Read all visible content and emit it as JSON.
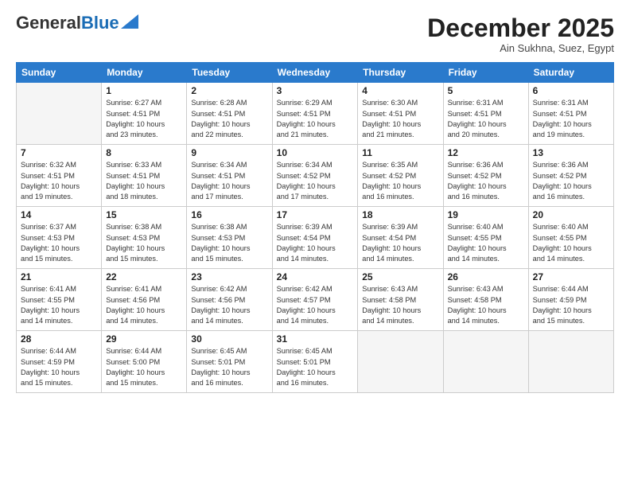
{
  "header": {
    "logo_general": "General",
    "logo_blue": "Blue",
    "month": "December 2025",
    "location": "Ain Sukhna, Suez, Egypt"
  },
  "days_of_week": [
    "Sunday",
    "Monday",
    "Tuesday",
    "Wednesday",
    "Thursday",
    "Friday",
    "Saturday"
  ],
  "weeks": [
    [
      {
        "day": "",
        "info": ""
      },
      {
        "day": "1",
        "info": "Sunrise: 6:27 AM\nSunset: 4:51 PM\nDaylight: 10 hours\nand 23 minutes."
      },
      {
        "day": "2",
        "info": "Sunrise: 6:28 AM\nSunset: 4:51 PM\nDaylight: 10 hours\nand 22 minutes."
      },
      {
        "day": "3",
        "info": "Sunrise: 6:29 AM\nSunset: 4:51 PM\nDaylight: 10 hours\nand 21 minutes."
      },
      {
        "day": "4",
        "info": "Sunrise: 6:30 AM\nSunset: 4:51 PM\nDaylight: 10 hours\nand 21 minutes."
      },
      {
        "day": "5",
        "info": "Sunrise: 6:31 AM\nSunset: 4:51 PM\nDaylight: 10 hours\nand 20 minutes."
      },
      {
        "day": "6",
        "info": "Sunrise: 6:31 AM\nSunset: 4:51 PM\nDaylight: 10 hours\nand 19 minutes."
      }
    ],
    [
      {
        "day": "7",
        "info": "Sunrise: 6:32 AM\nSunset: 4:51 PM\nDaylight: 10 hours\nand 19 minutes."
      },
      {
        "day": "8",
        "info": "Sunrise: 6:33 AM\nSunset: 4:51 PM\nDaylight: 10 hours\nand 18 minutes."
      },
      {
        "day": "9",
        "info": "Sunrise: 6:34 AM\nSunset: 4:51 PM\nDaylight: 10 hours\nand 17 minutes."
      },
      {
        "day": "10",
        "info": "Sunrise: 6:34 AM\nSunset: 4:52 PM\nDaylight: 10 hours\nand 17 minutes."
      },
      {
        "day": "11",
        "info": "Sunrise: 6:35 AM\nSunset: 4:52 PM\nDaylight: 10 hours\nand 16 minutes."
      },
      {
        "day": "12",
        "info": "Sunrise: 6:36 AM\nSunset: 4:52 PM\nDaylight: 10 hours\nand 16 minutes."
      },
      {
        "day": "13",
        "info": "Sunrise: 6:36 AM\nSunset: 4:52 PM\nDaylight: 10 hours\nand 16 minutes."
      }
    ],
    [
      {
        "day": "14",
        "info": "Sunrise: 6:37 AM\nSunset: 4:53 PM\nDaylight: 10 hours\nand 15 minutes."
      },
      {
        "day": "15",
        "info": "Sunrise: 6:38 AM\nSunset: 4:53 PM\nDaylight: 10 hours\nand 15 minutes."
      },
      {
        "day": "16",
        "info": "Sunrise: 6:38 AM\nSunset: 4:53 PM\nDaylight: 10 hours\nand 15 minutes."
      },
      {
        "day": "17",
        "info": "Sunrise: 6:39 AM\nSunset: 4:54 PM\nDaylight: 10 hours\nand 14 minutes."
      },
      {
        "day": "18",
        "info": "Sunrise: 6:39 AM\nSunset: 4:54 PM\nDaylight: 10 hours\nand 14 minutes."
      },
      {
        "day": "19",
        "info": "Sunrise: 6:40 AM\nSunset: 4:55 PM\nDaylight: 10 hours\nand 14 minutes."
      },
      {
        "day": "20",
        "info": "Sunrise: 6:40 AM\nSunset: 4:55 PM\nDaylight: 10 hours\nand 14 minutes."
      }
    ],
    [
      {
        "day": "21",
        "info": "Sunrise: 6:41 AM\nSunset: 4:55 PM\nDaylight: 10 hours\nand 14 minutes."
      },
      {
        "day": "22",
        "info": "Sunrise: 6:41 AM\nSunset: 4:56 PM\nDaylight: 10 hours\nand 14 minutes."
      },
      {
        "day": "23",
        "info": "Sunrise: 6:42 AM\nSunset: 4:56 PM\nDaylight: 10 hours\nand 14 minutes."
      },
      {
        "day": "24",
        "info": "Sunrise: 6:42 AM\nSunset: 4:57 PM\nDaylight: 10 hours\nand 14 minutes."
      },
      {
        "day": "25",
        "info": "Sunrise: 6:43 AM\nSunset: 4:58 PM\nDaylight: 10 hours\nand 14 minutes."
      },
      {
        "day": "26",
        "info": "Sunrise: 6:43 AM\nSunset: 4:58 PM\nDaylight: 10 hours\nand 14 minutes."
      },
      {
        "day": "27",
        "info": "Sunrise: 6:44 AM\nSunset: 4:59 PM\nDaylight: 10 hours\nand 15 minutes."
      }
    ],
    [
      {
        "day": "28",
        "info": "Sunrise: 6:44 AM\nSunset: 4:59 PM\nDaylight: 10 hours\nand 15 minutes."
      },
      {
        "day": "29",
        "info": "Sunrise: 6:44 AM\nSunset: 5:00 PM\nDaylight: 10 hours\nand 15 minutes."
      },
      {
        "day": "30",
        "info": "Sunrise: 6:45 AM\nSunset: 5:01 PM\nDaylight: 10 hours\nand 16 minutes."
      },
      {
        "day": "31",
        "info": "Sunrise: 6:45 AM\nSunset: 5:01 PM\nDaylight: 10 hours\nand 16 minutes."
      },
      {
        "day": "",
        "info": ""
      },
      {
        "day": "",
        "info": ""
      },
      {
        "day": "",
        "info": ""
      }
    ]
  ]
}
